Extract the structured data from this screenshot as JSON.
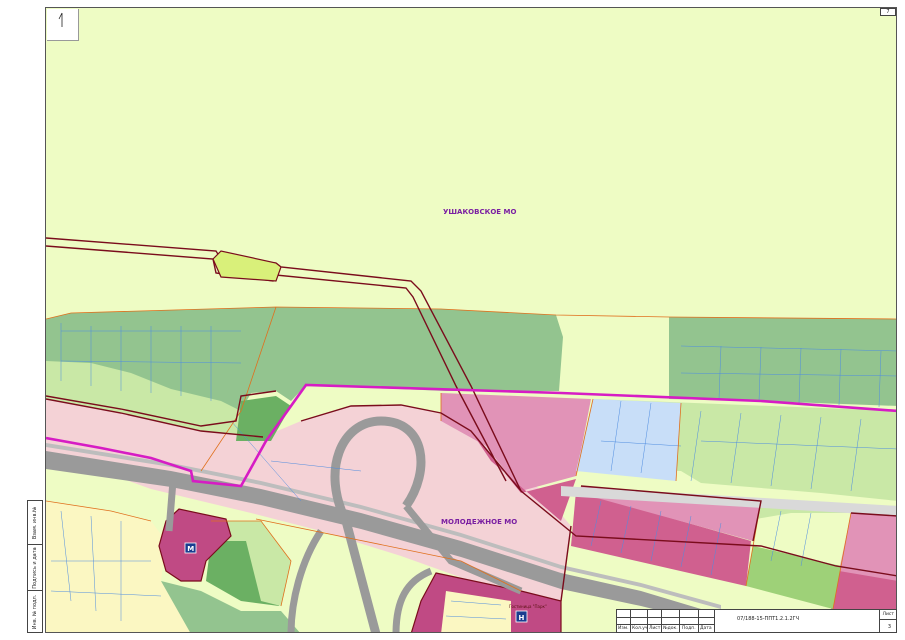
{
  "map": {
    "labels": {
      "ushakovskoe": "УШАКОВСКОЕ МО",
      "molodezhnoe": "МОЛОДЕЖНОЕ МО",
      "hotel_caption": "Гостиница \"Парк\""
    },
    "north_label": "N",
    "markers": {
      "metro": "M",
      "hotel": "H"
    },
    "colors": {
      "agricultural": "#eefcc4",
      "forest": "#93c48f",
      "light_green": "#c9e8a6",
      "pink_zone": "#f4d2d6",
      "magenta_zone": "#d0608f",
      "mid_pink": "#e193b7",
      "light_blue": "#c8def8",
      "yellow_zone": "#fbf7c2",
      "road": "#9a9a9a",
      "boundary_magenta": "#d61cc4",
      "boundary_maroon": "#7a0c1c",
      "orange_outline": "#e0701e"
    }
  },
  "page_corner_number": "7",
  "left_stamp": {
    "cells": [
      "Инв. № подл.",
      "Подпись и дата",
      "Взам. инв.№"
    ]
  },
  "title_block": {
    "headers": [
      "Изм.",
      "Кол.уч",
      "Лист",
      "№док.",
      "Подп.",
      "Дата"
    ],
    "document_code": "07/188-15-ППТ1.2.1.2ГЧ",
    "sheet_label": "Лист",
    "sheet_number": "3"
  }
}
